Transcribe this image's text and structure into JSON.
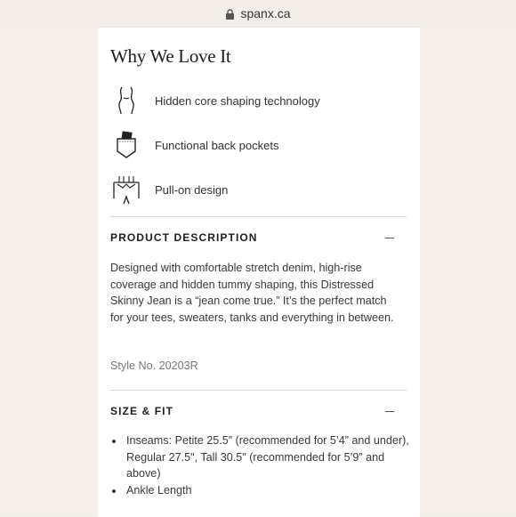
{
  "browser": {
    "url": "spanx.ca"
  },
  "why_section": {
    "title": "Why We Love It",
    "features": [
      {
        "icon": "body-curve-icon",
        "label": "Hidden core shaping technology"
      },
      {
        "icon": "back-pocket-icon",
        "label": "Functional back pockets"
      },
      {
        "icon": "pull-on-jeans-icon",
        "label": "Pull-on design"
      }
    ]
  },
  "product_description": {
    "heading": "PRODUCT DESCRIPTION",
    "body": "Designed with comfortable stretch denim, high-rise coverage and hidden tummy shaping, this Distressed Skinny Jean is a “jean come true.” It’s the perfect match for your tees, sweaters, tanks and everything in between.",
    "style_no": "Style No. 20203R"
  },
  "size_fit": {
    "heading": "SIZE & FIT",
    "items": [
      "Inseams: Petite 25.5” (recommended for 5’4” and under), Regular 27.5\", Tall 30.5\" (recommended for 5’9” and above)",
      "Ankle Length"
    ]
  }
}
